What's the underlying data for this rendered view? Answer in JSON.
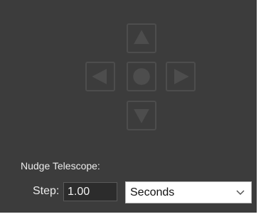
{
  "directional_pad": {
    "up_icon": "triangle-up-icon",
    "left_icon": "triangle-left-icon",
    "stop_icon": "circle-icon",
    "right_icon": "triangle-right-icon",
    "down_icon": "triangle-down-icon",
    "button_color": "#4d4d4d"
  },
  "nudge": {
    "label": "Nudge Telescope:",
    "step_label": "Step:",
    "step_value": "1.00",
    "unit_selected": "Seconds"
  },
  "colors": {
    "panel_bg": "#3c3c3c",
    "text": "#ececec"
  }
}
